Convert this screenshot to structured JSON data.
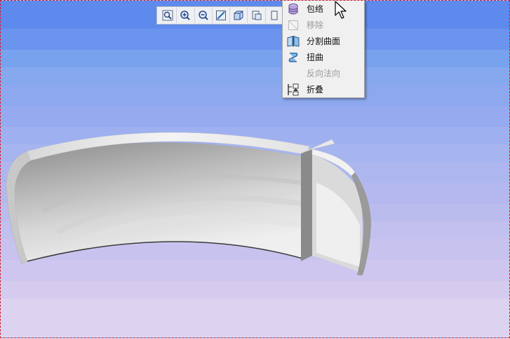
{
  "toolbar": {
    "buttons": [
      {
        "icon": "zoom-fit-icon"
      },
      {
        "icon": "zoom-in-icon"
      },
      {
        "icon": "zoom-out-icon"
      },
      {
        "icon": "view-orientation-icon"
      },
      {
        "icon": "display-style-icon"
      },
      {
        "icon": "view-manager-icon"
      },
      {
        "icon": "more-tools-icon"
      }
    ]
  },
  "context_menu": {
    "items": [
      {
        "label": "包络",
        "icon": "wrap-icon",
        "enabled": true
      },
      {
        "label": "移除",
        "icon": "remove-icon",
        "enabled": false
      },
      {
        "label": "分割曲面",
        "icon": "split-surface-icon",
        "enabled": true
      },
      {
        "label": "扭曲",
        "icon": "twist-icon",
        "enabled": true
      },
      {
        "label": "反向法向",
        "icon": "reverse-normal-icon",
        "enabled": false
      },
      {
        "label": "折叠",
        "icon": "fold-icon",
        "enabled": true
      }
    ]
  },
  "colors": {
    "background_top": "#5d8aec",
    "background_bottom": "#dcd3f0",
    "frame_border": "#d0202a",
    "menu_background": "#f0f0f0",
    "disabled_text": "#9a9a9a"
  }
}
